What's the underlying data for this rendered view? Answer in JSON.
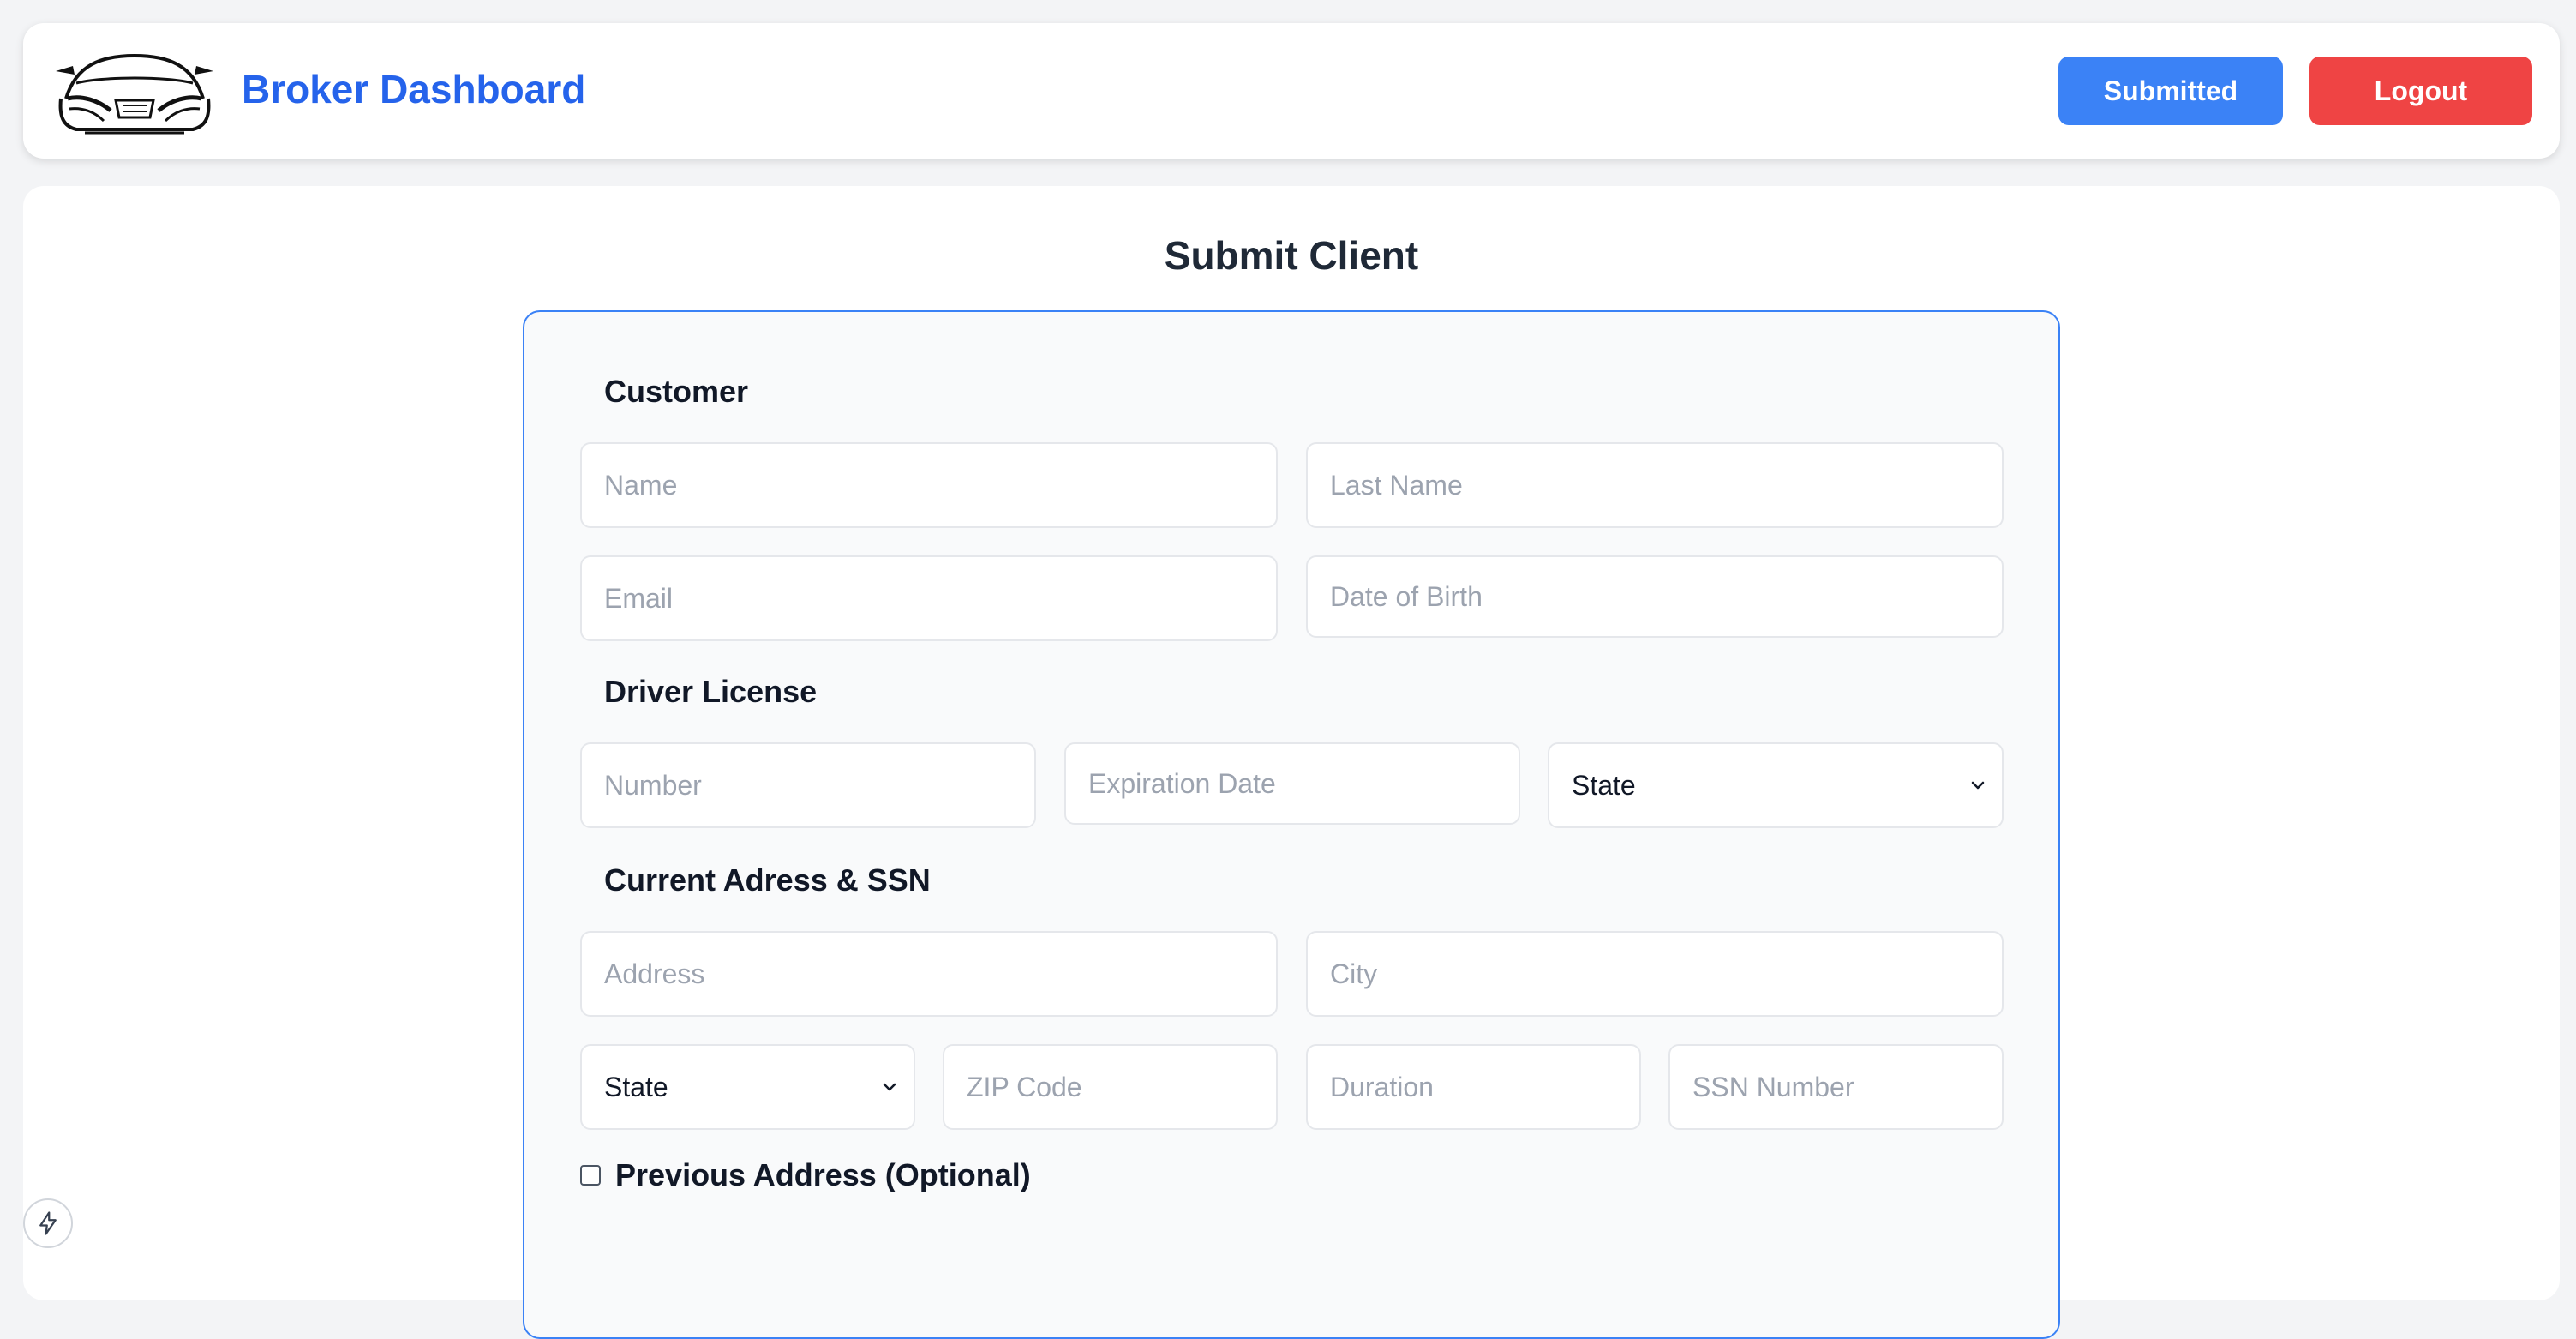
{
  "header": {
    "title": "Broker Dashboard",
    "submitted_label": "Submitted",
    "logout_label": "Logout"
  },
  "form": {
    "page_title": "Submit Client",
    "customer": {
      "title": "Customer",
      "name_placeholder": "Name",
      "last_name_placeholder": "Last Name",
      "email_placeholder": "Email",
      "dob_placeholder": "Date of Birth"
    },
    "license": {
      "title": "Driver License",
      "number_placeholder": "Number",
      "expiration_placeholder": "Expiration Date",
      "state_value": "State"
    },
    "address": {
      "title": "Current Adress & SSN",
      "address_placeholder": "Address",
      "city_placeholder": "City",
      "state_value": "State",
      "zip_placeholder": "ZIP Code",
      "duration_placeholder": "Duration",
      "ssn_placeholder": "SSN Number"
    },
    "previous_address_label": "Previous Address (Optional)"
  },
  "colors": {
    "accent": "#2563eb",
    "submitted_button": "#3b82f6",
    "logout_button": "#ef4444",
    "form_border": "#3b82f6"
  },
  "icons": {
    "logo": "car-logo-icon",
    "select_arrow": "chevron-down-icon",
    "badge": "bolt-icon"
  }
}
